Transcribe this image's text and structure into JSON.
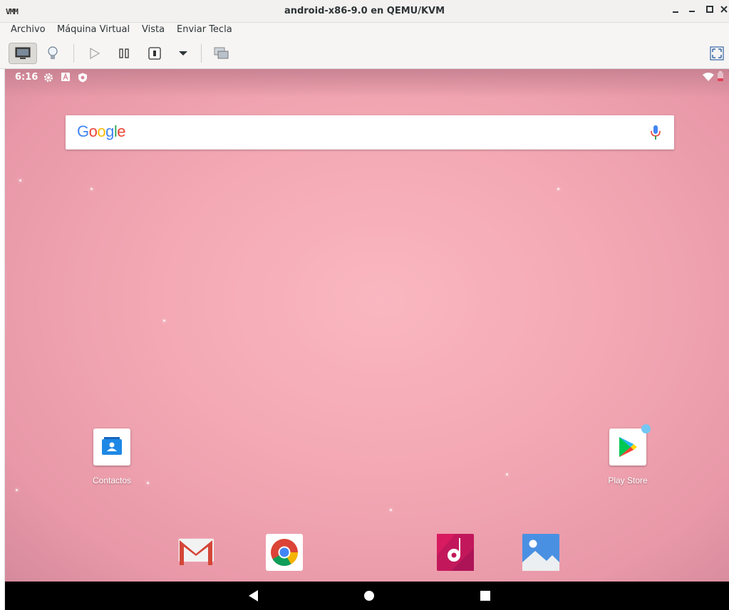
{
  "window": {
    "title": "android-x86-9.0 en QEMU/KVM",
    "logo": "VMM",
    "controls": [
      "minimize",
      "maximize",
      "close"
    ]
  },
  "menubar": {
    "items": [
      "Archivo",
      "Máquina Virtual",
      "Vista",
      "Enviar Tecla"
    ]
  },
  "toolbar": {
    "buttons": [
      "console-view",
      "details-view",
      "run",
      "pause",
      "shutdown",
      "shutdown-menu",
      "snapshots",
      "fullscreen"
    ]
  },
  "android": {
    "status_bar": {
      "time": "6:16",
      "icons": [
        "settings-icon",
        "a-icon",
        "shield-icon",
        "wifi-icon",
        "battery-icon"
      ]
    },
    "search": {
      "logo": "Google"
    },
    "apps": [
      {
        "label": "Contactos",
        "icon": "contacts-icon"
      },
      {
        "label": "Play Store",
        "icon": "play-store-icon"
      }
    ],
    "dock": [
      "gmail-icon",
      "chrome-icon",
      "music-icon",
      "photos-icon"
    ],
    "nav": [
      "back-icon",
      "home-icon",
      "recents-icon"
    ]
  }
}
